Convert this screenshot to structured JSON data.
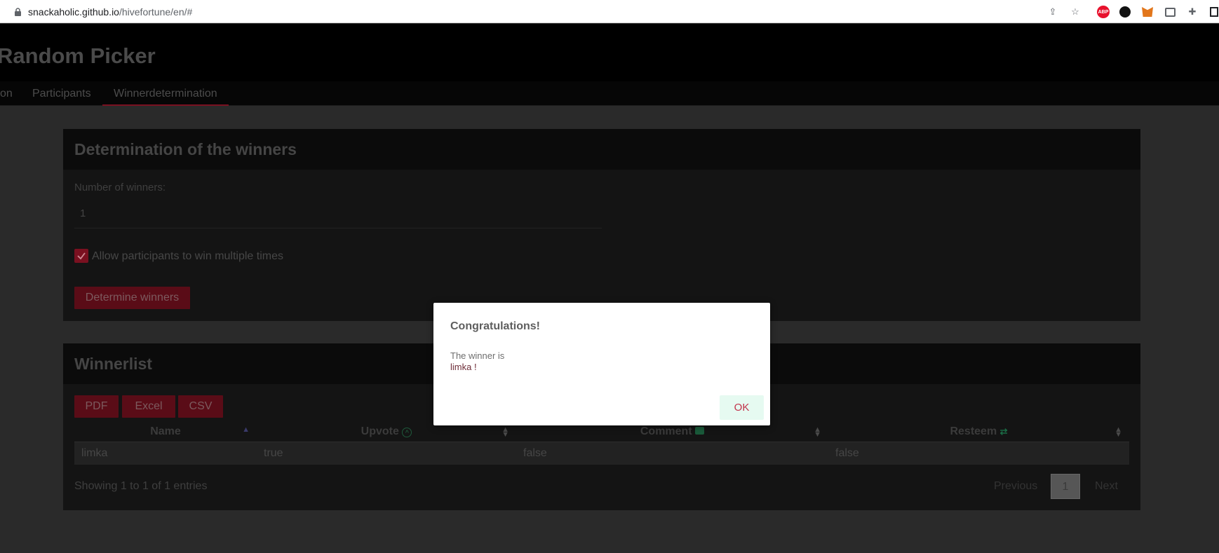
{
  "browser": {
    "url_host": "snackaholic.github.io",
    "url_path": "/hivefortune/en/#"
  },
  "app": {
    "title": "Random Picker",
    "nav": {
      "tabs": [
        {
          "label": "on"
        },
        {
          "label": "Participants"
        },
        {
          "label": "Winnerdetermination",
          "active": true
        }
      ]
    }
  },
  "determination": {
    "title": "Determination of the winners",
    "winners_label": "Number of winners:",
    "winners_value": "1",
    "allow_multiple_label": "Allow participants to win multiple times",
    "allow_multiple_checked": true,
    "determine_button": "Determine winners"
  },
  "winnerlist": {
    "title": "Winnerlist",
    "export_buttons": [
      "PDF",
      "Excel",
      "CSV"
    ],
    "columns": [
      "Name",
      "Upvote",
      "Comment",
      "Resteem"
    ],
    "rows": [
      [
        "limka",
        "true",
        "false",
        "false"
      ]
    ],
    "info": "Showing 1 to 1 of 1 entries",
    "pagination": {
      "previous": "Previous",
      "current": "1",
      "next": "Next"
    }
  },
  "modal": {
    "title": "Congratulations!",
    "line1": "The winner is",
    "line2": "limka !",
    "ok": "OK"
  },
  "colors": {
    "accent": "#7a1020",
    "ok_button_bg": "#e6faf1",
    "ok_button_text": "#c2334b"
  }
}
